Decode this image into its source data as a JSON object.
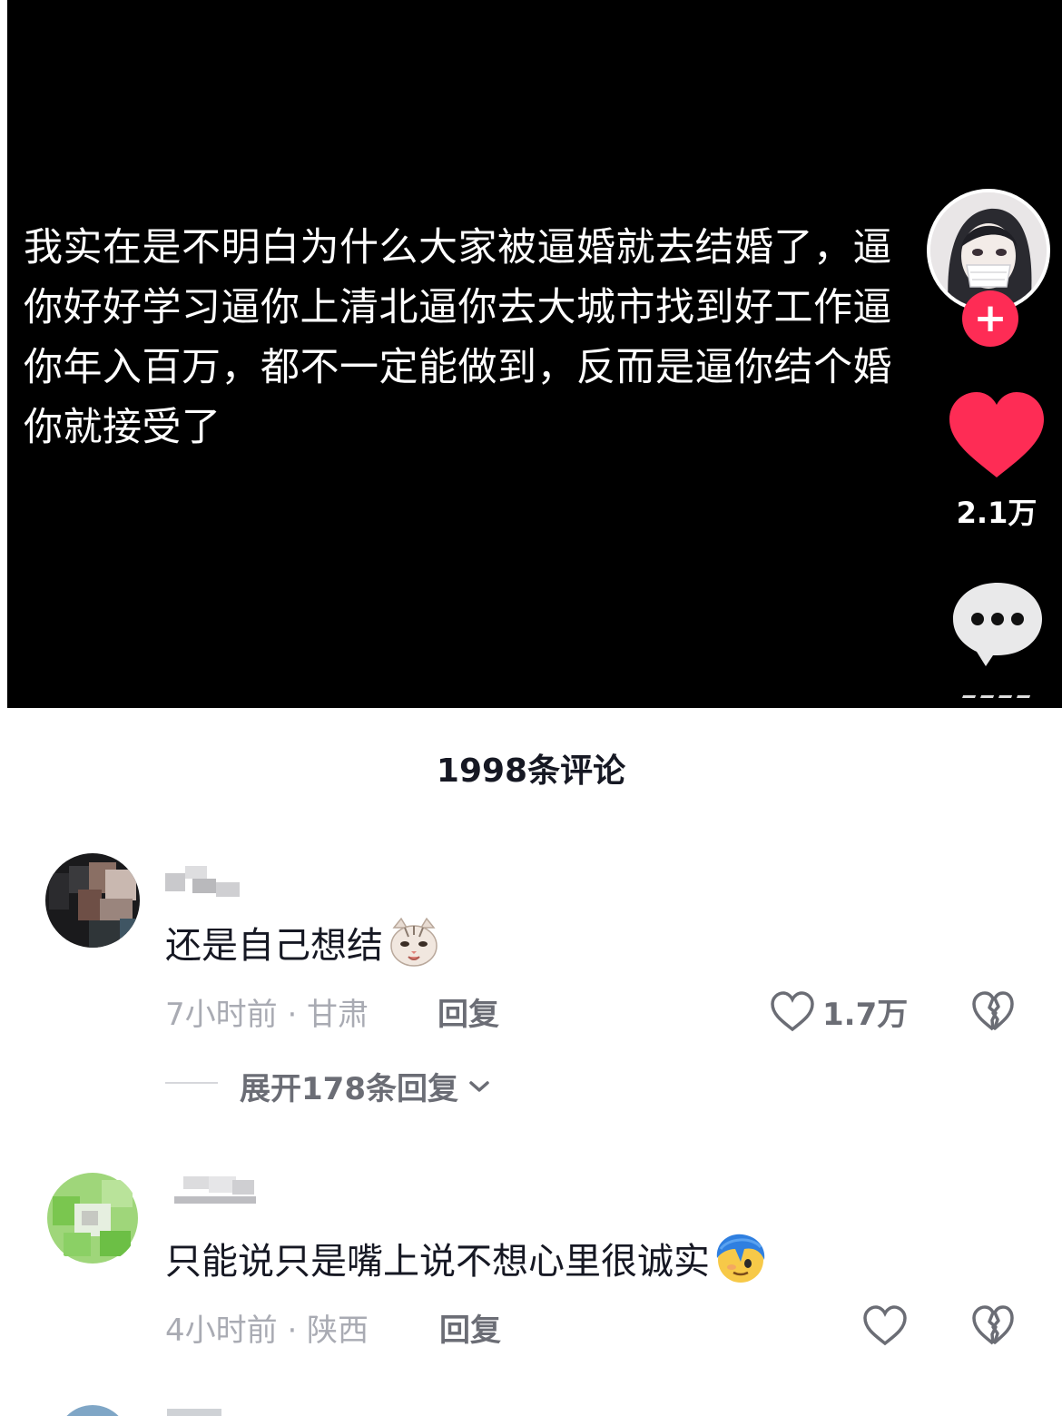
{
  "video": {
    "caption": "我实在是不明白为什么大家被逼婚就去结婚了，逼你好好学习逼你上清北逼你去大城市找到好工作逼你年入百万，都不一定能做到，反而是逼你结个婚你就接受了",
    "follow_symbol": "+",
    "like_count": "2.1万",
    "accent_color": "#fe2c55"
  },
  "comments_panel": {
    "title": "1998条评论",
    "comments": [
      {
        "text": "还是自己想结",
        "emoji": "cat-face-emoji",
        "time_location": "7小时前 · 甘肃",
        "reply_label": "回复",
        "like_count": "1.7万",
        "expand_label": "展开178条回复"
      },
      {
        "text": "只能说只是嘴上说不想心里很诚实",
        "emoji": "shy-face-emoji",
        "time_location": "4小时前 · 陕西",
        "reply_label": "回复",
        "like_count": ""
      }
    ]
  }
}
